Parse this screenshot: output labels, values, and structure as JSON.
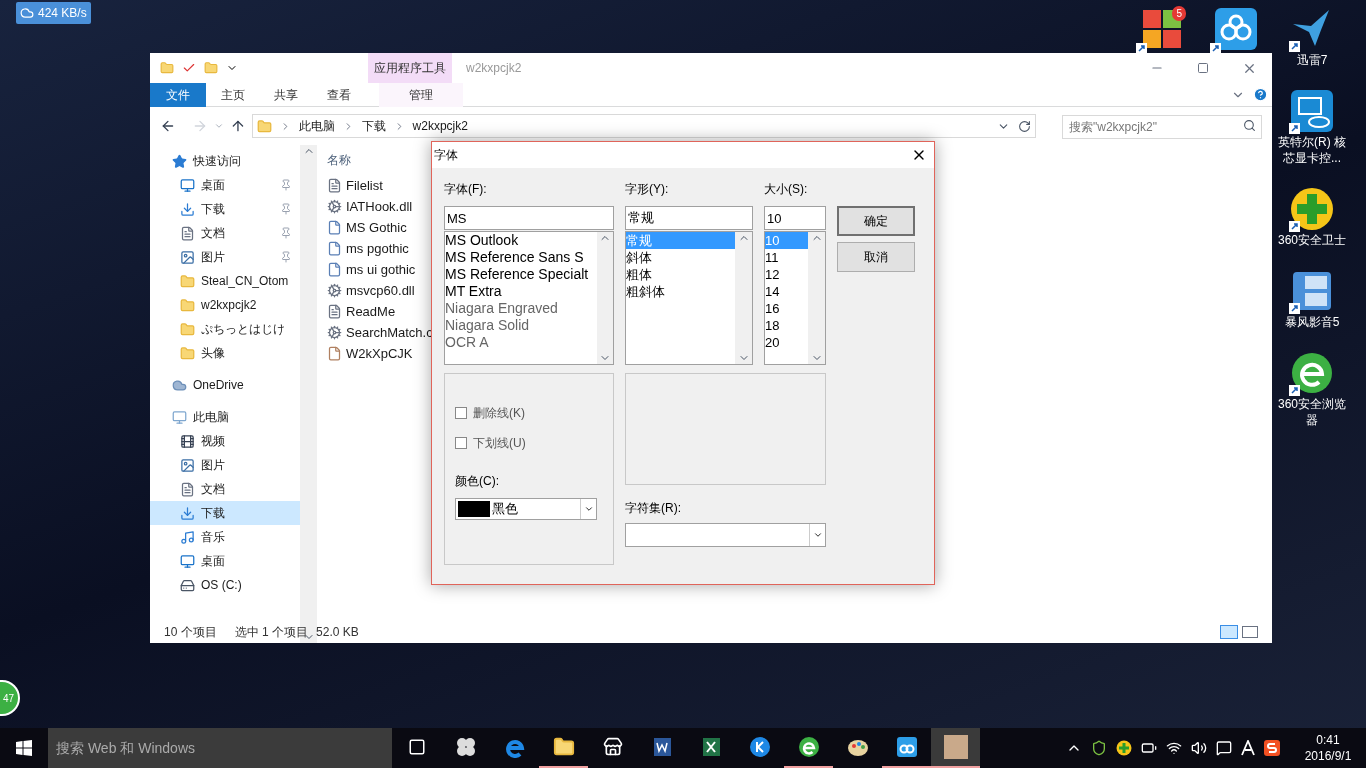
{
  "desktop": {
    "speed_widget": "424 KB/s",
    "top_icons": [
      {
        "kind": "tiles",
        "badge": "5"
      },
      {
        "kind": "cloud"
      }
    ],
    "icons": [
      {
        "kind": "bird",
        "label": "迅雷7"
      },
      {
        "kind": "intel",
        "label": "英特尔(R) 核芯显卡控..."
      },
      {
        "kind": "guard",
        "label": "360安全卫士"
      },
      {
        "kind": "player",
        "label": "暴风影音5"
      },
      {
        "kind": "browser",
        "label": "360安全浏览器"
      }
    ],
    "floating_ball": "47"
  },
  "explorer": {
    "quick_bar": [
      {
        "kind": "folder"
      },
      {
        "kind": "check"
      },
      {
        "kind": "folder"
      }
    ],
    "context_tab": "应用程序工具",
    "title": "w2kxpcjk2",
    "tabs": [
      {
        "label": "文件",
        "selected": true
      },
      {
        "label": "主页",
        "selected": false
      },
      {
        "label": "共享",
        "selected": false
      },
      {
        "label": "查看",
        "selected": false
      },
      {
        "label": "管理",
        "selected": false
      }
    ],
    "path": [
      "此电脑",
      "下载",
      "w2kxpcjk2"
    ],
    "search": {
      "placeholder": "搜索\"w2kxpcjk2\""
    },
    "nav": [
      {
        "kind": "star",
        "label": "快速访问",
        "selected": false,
        "children": [
          {
            "kind": "desktop",
            "label": "桌面",
            "pinned": true,
            "selected": false
          },
          {
            "kind": "download",
            "label": "下载",
            "pinned": true,
            "selected": false
          },
          {
            "kind": "doc",
            "label": "文档",
            "pinned": true,
            "selected": false
          },
          {
            "kind": "picture",
            "label": "图片",
            "pinned": true,
            "selected": false
          },
          {
            "kind": "folder",
            "label": "Steal_CN_Otom",
            "pinned": false,
            "selected": false
          },
          {
            "kind": "folder",
            "label": "w2kxpcjk2",
            "pinned": false,
            "selected": false
          },
          {
            "kind": "folder",
            "label": "ぷちっとはじけ",
            "pinned": false,
            "selected": false
          },
          {
            "kind": "folder",
            "label": "头像",
            "pinned": false,
            "selected": false
          }
        ]
      },
      {
        "kind": "cloud",
        "label": "OneDrive",
        "selected": false
      },
      {
        "kind": "pc",
        "label": "此电脑",
        "selected": false,
        "children": [
          {
            "kind": "video",
            "label": "视频",
            "pinned": false,
            "selected": false
          },
          {
            "kind": "picture",
            "label": "图片",
            "pinned": false,
            "selected": false
          },
          {
            "kind": "doc",
            "label": "文档",
            "pinned": false,
            "selected": false
          },
          {
            "kind": "download",
            "label": "下载",
            "pinned": false,
            "selected": true
          },
          {
            "kind": "music",
            "label": "音乐",
            "pinned": false,
            "selected": false
          },
          {
            "kind": "desktop",
            "label": "桌面",
            "pinned": false,
            "selected": false
          },
          {
            "kind": "drive",
            "label": "OS (C:)",
            "pinned": false,
            "selected": false
          }
        ]
      }
    ],
    "column": "名称",
    "files": [
      {
        "kind": "text",
        "name": "Filelist"
      },
      {
        "kind": "dll",
        "name": "IATHook.dll"
      },
      {
        "kind": "font",
        "name": "MS Gothic"
      },
      {
        "kind": "font",
        "name": "ms pgothic"
      },
      {
        "kind": "font",
        "name": "ms ui gothic"
      },
      {
        "kind": "dll",
        "name": "msvcp60.dll"
      },
      {
        "kind": "text",
        "name": "ReadMe"
      },
      {
        "kind": "dll",
        "name": "SearchMatch.c"
      },
      {
        "kind": "app",
        "name": "W2kXpCJK"
      }
    ],
    "status": {
      "count": "10 个项目",
      "selection": "选中 1 个项目",
      "size": "52.0 KB"
    }
  },
  "font_dialog": {
    "title": "字体",
    "font": {
      "label": "字体(F):",
      "value": "MS",
      "items": [
        {
          "label": "MS Outlook",
          "selected": false
        },
        {
          "label": "MS Reference Sans S",
          "selected": false
        },
        {
          "label": "MS Reference Specialt",
          "selected": false
        },
        {
          "label": "MT Extra",
          "selected": false
        },
        {
          "label": "Niagara Engraved",
          "selected": false
        },
        {
          "label": "Niagara Solid",
          "selected": false
        },
        {
          "label": "OCR A",
          "selected": false
        }
      ]
    },
    "style": {
      "label": "字形(Y):",
      "value": "常规",
      "items": [
        {
          "label": "常规",
          "selected": true
        },
        {
          "label": "斜体",
          "selected": false
        },
        {
          "label": "粗体",
          "selected": false
        },
        {
          "label": "粗斜体",
          "selected": false
        }
      ]
    },
    "size": {
      "label": "大小(S):",
      "value": "10",
      "items": [
        {
          "label": "10",
          "selected": true
        },
        {
          "label": "11",
          "selected": false
        },
        {
          "label": "12",
          "selected": false
        },
        {
          "label": "14",
          "selected": false
        },
        {
          "label": "16",
          "selected": false
        },
        {
          "label": "18",
          "selected": false
        },
        {
          "label": "20",
          "selected": false
        }
      ]
    },
    "buttons": [
      "确定",
      "取消"
    ],
    "effects": [
      {
        "label": "删除线(K)",
        "checked": false
      },
      {
        "label": "下划线(U)",
        "checked": false
      }
    ],
    "color": {
      "label": "颜色(C):",
      "value": "黑色",
      "color": "#000000"
    },
    "charset": {
      "label": "字符集(R):"
    }
  },
  "taskbar": {
    "search": {
      "placeholder": "搜索 Web 和 Windows"
    },
    "apps": [
      {
        "kind": "taskview",
        "running": false,
        "selected": false
      },
      {
        "kind": "pinwheel",
        "running": false,
        "selected": false
      },
      {
        "kind": "edge",
        "running": false,
        "selected": false
      },
      {
        "kind": "explorer",
        "running": true,
        "selected": false
      },
      {
        "kind": "store",
        "running": false,
        "selected": false
      },
      {
        "kind": "word",
        "running": false,
        "selected": false
      },
      {
        "kind": "excel",
        "running": false,
        "selected": false
      },
      {
        "kind": "k",
        "running": false,
        "selected": false
      },
      {
        "kind": "browser",
        "running": true,
        "selected": false
      },
      {
        "kind": "paint",
        "running": false,
        "selected": false
      },
      {
        "kind": "cloud",
        "running": true,
        "selected": false
      },
      {
        "kind": "photo",
        "running": true,
        "selected": true
      }
    ],
    "tray": [
      {
        "kind": "chevron"
      },
      {
        "kind": "shield"
      },
      {
        "kind": "plus"
      },
      {
        "kind": "battery"
      },
      {
        "kind": "wifi"
      },
      {
        "kind": "volume"
      },
      {
        "kind": "message"
      },
      {
        "kind": "ime"
      },
      {
        "kind": "sogou"
      }
    ],
    "time": "0:41",
    "date": "2016/9/1"
  }
}
